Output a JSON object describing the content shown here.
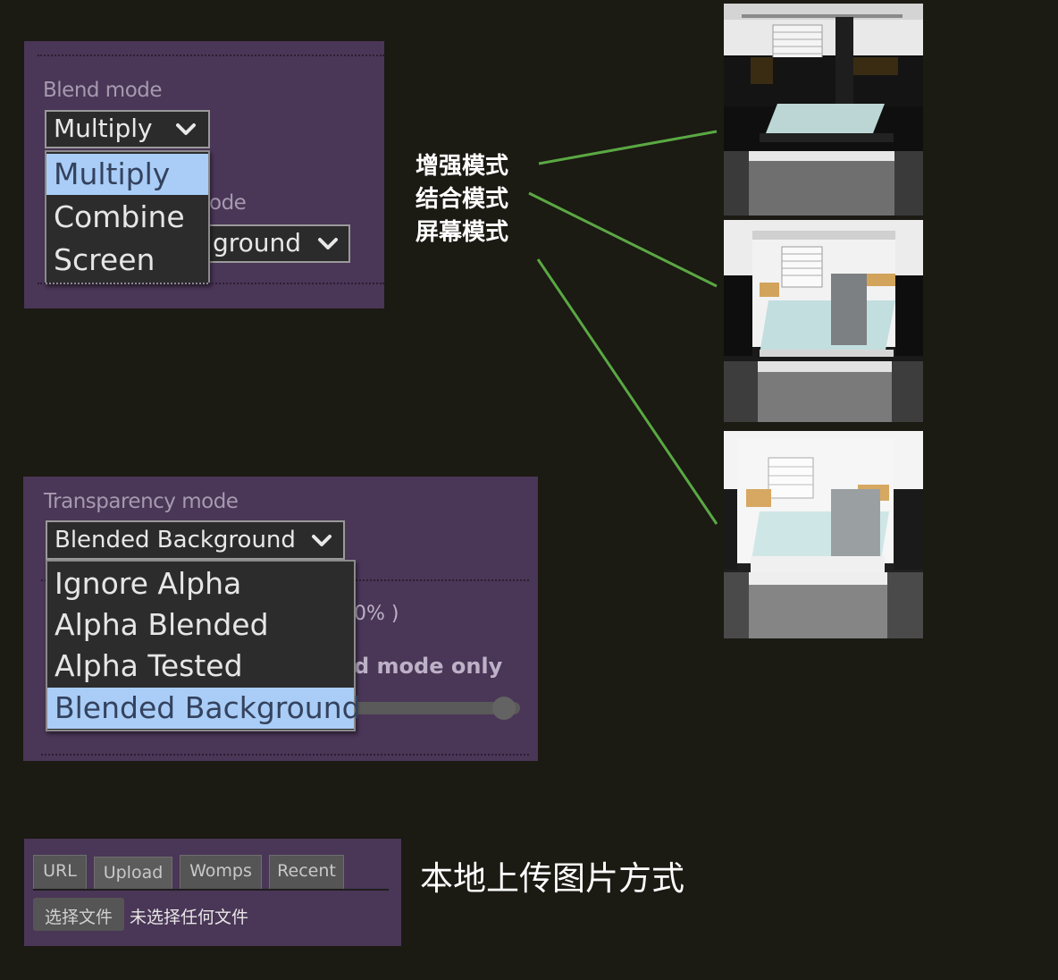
{
  "blend_panel": {
    "label": "Blend mode",
    "selected": "Multiply",
    "options": [
      {
        "label": "Multiply",
        "selected": true
      },
      {
        "label": "Combine",
        "selected": false
      },
      {
        "label": "Screen",
        "selected": false
      }
    ],
    "behind_label_fragment": "ode",
    "behind_select_fragment": "ground"
  },
  "transparency_panel": {
    "label": "Transparency mode",
    "selected": "Blended Background",
    "options": [
      {
        "label": "Ignore Alpha",
        "selected": false
      },
      {
        "label": "Alpha Blended",
        "selected": false
      },
      {
        "label": "Alpha Tested",
        "selected": false
      },
      {
        "label": "Blended Background",
        "selected": true
      }
    ],
    "behind_fragment_1": "0% )",
    "behind_fragment_2": "d mode only"
  },
  "annotations": {
    "line1": "增强模式",
    "line2": "结合模式",
    "line3": "屏幕模式",
    "upload_caption": "本地上传图片方式"
  },
  "upload_panel": {
    "tabs": [
      "URL",
      "Upload",
      "Womps",
      "Recent"
    ],
    "choose_button": "选择文件",
    "no_file_text": "未选择任何文件"
  },
  "colors": {
    "panel_bg": "#4a3657",
    "page_bg": "#1b1a13",
    "selected_option": "#a9cdf6",
    "connector_line": "#5aa843"
  }
}
